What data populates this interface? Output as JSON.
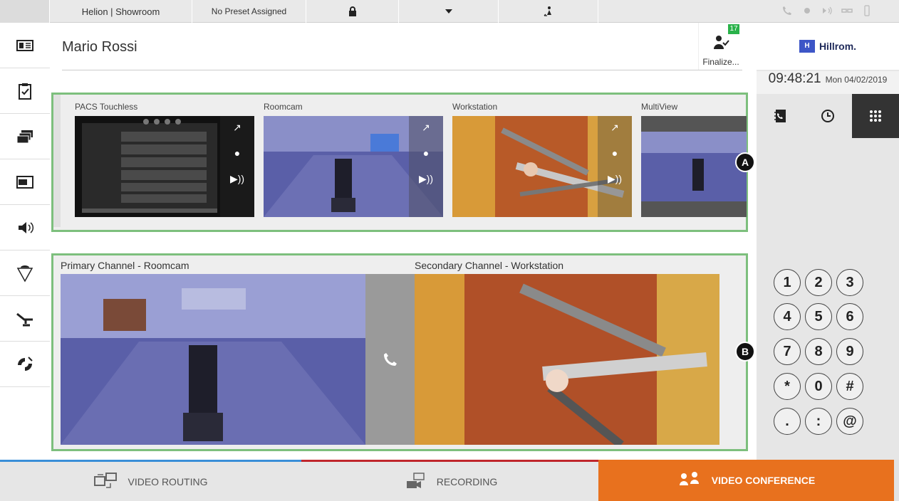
{
  "topbar": {
    "app_title": "Helion | Showroom",
    "preset": "No Preset Assigned"
  },
  "patient": {
    "name": "Mario Rossi"
  },
  "finalize": {
    "label": "Finalize...",
    "count": "17"
  },
  "brand": {
    "name": "Hillrom.",
    "logo": "H"
  },
  "clock": {
    "time": "09:48:21",
    "date": "Mon 04/02/2019"
  },
  "sources": [
    {
      "name": "PACS Touchless"
    },
    {
      "name": "Roomcam"
    },
    {
      "name": "Workstation"
    },
    {
      "name": "MultiView"
    }
  ],
  "channels": {
    "primary": "Primary Channel - Roomcam",
    "secondary": "Secondary Channel - Workstation"
  },
  "markers": {
    "a": "A",
    "b": "B"
  },
  "keypad": [
    "1",
    "2",
    "3",
    "4",
    "5",
    "6",
    "7",
    "8",
    "9",
    "*",
    "0",
    "#",
    ".",
    ":",
    "@"
  ],
  "bottom_tabs": {
    "routing": "VIDEO ROUTING",
    "recording": "RECORDING",
    "conference": "VIDEO CONFERENCE"
  },
  "colors": {
    "panel_border": "#7dbf7d",
    "active_tab": "#e8711e",
    "routing_accent": "#3a8fd8",
    "recording_accent": "#c0262c",
    "badge": "#2ab24a"
  }
}
